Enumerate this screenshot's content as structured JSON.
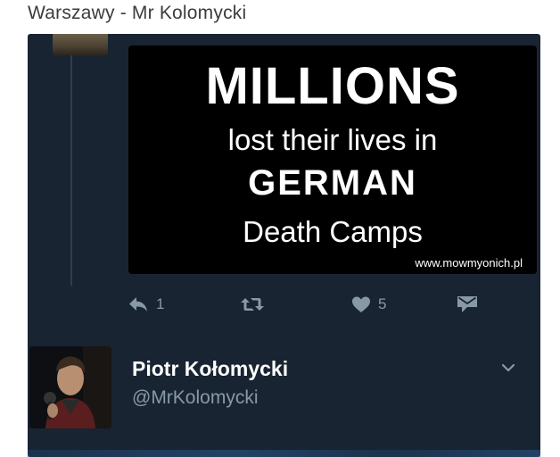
{
  "caption": {
    "text": "Warszawy - Mr Kolomycki"
  },
  "media": {
    "line1": "MILLIONS",
    "line2": "lost their lives in",
    "line3": "GERMAN",
    "line4": "Death Camps",
    "url": "www.mowmyonich.pl"
  },
  "actions": {
    "reply_count": "1",
    "like_count": "5"
  },
  "profile": {
    "display_name": "Piotr Kołomycki",
    "handle": "@MrKolomycki"
  },
  "colors": {
    "panel_bg": "#182431",
    "muted": "#8899a6",
    "text_light": "#ffffff"
  },
  "icons": [
    "reply-icon",
    "retweet-icon",
    "heart-icon",
    "direct-message-icon",
    "chevron-down-icon"
  ]
}
